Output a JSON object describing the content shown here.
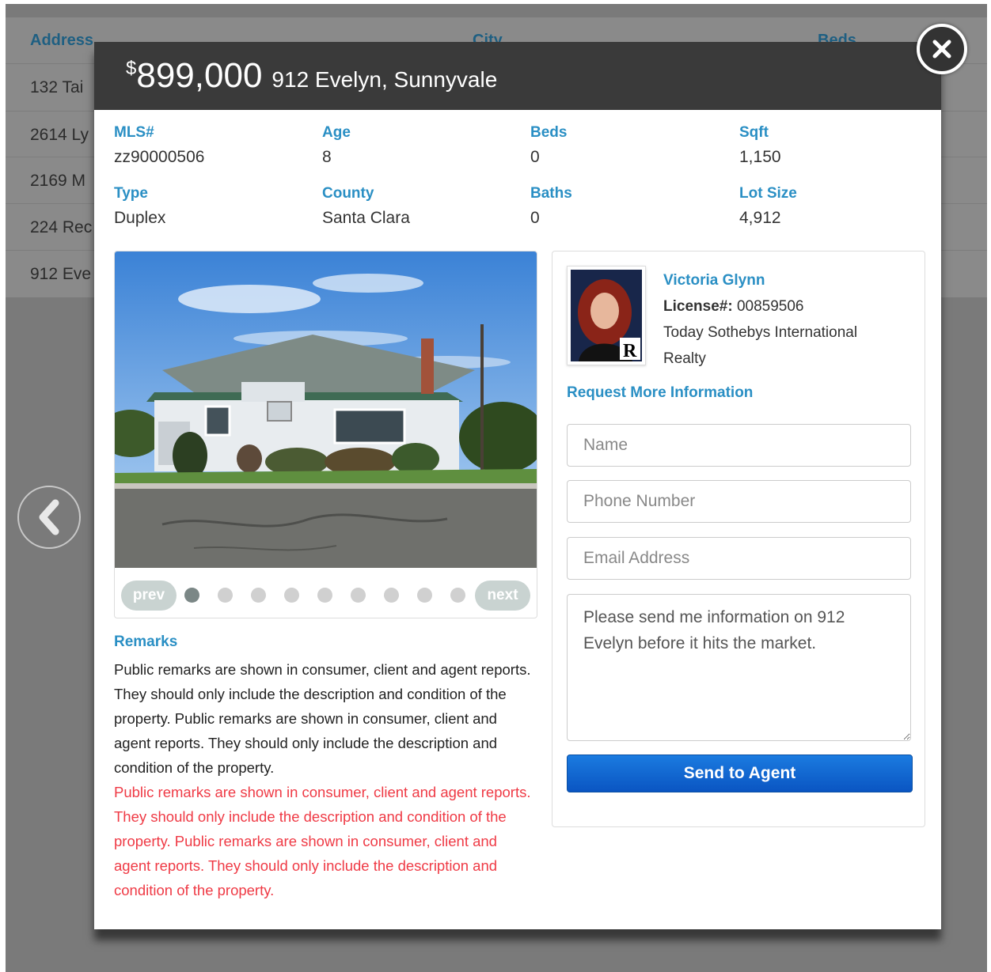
{
  "background": {
    "table_headers": [
      "Address",
      "City",
      "Beds"
    ],
    "rows": [
      "132 Tai",
      "2614 Ly",
      "2169 M",
      "224 Rec",
      "912 Eve"
    ]
  },
  "listing": {
    "price_symbol": "$",
    "price": "899,000",
    "address": "912 Evelyn, Sunnyvale"
  },
  "facts": {
    "mls_label": "MLS#",
    "mls_value": "zz90000506",
    "age_label": "Age",
    "age_value": "8",
    "beds_label": "Beds",
    "beds_value": "0",
    "sqft_label": "Sqft",
    "sqft_value": "1,150",
    "type_label": "Type",
    "type_value": "Duplex",
    "county_label": "County",
    "county_value": "Santa Clara",
    "baths_label": "Baths",
    "baths_value": "0",
    "lot_label": "Lot Size",
    "lot_value": "4,912"
  },
  "carousel": {
    "prev_label": "prev",
    "next_label": "next",
    "photo_count": 9,
    "active_index": 0
  },
  "remarks": {
    "title": "Remarks",
    "text": "Public remarks are shown in consumer, client and agent reports. They should only include the description and condition of the property.  Public remarks are shown in consumer, client and agent reports. They should only include the description and condition of the property.",
    "red_text": "Public remarks are shown in consumer, client and agent reports. They should only include the description and condition of the property.  Public remarks are shown in consumer, client and agent reports. They should only include the description and condition of the property."
  },
  "agent": {
    "name": "Victoria Glynn",
    "license_label": "License#:",
    "license_number": "00859506",
    "brokerage": "Today Sothebys International Realty"
  },
  "form": {
    "title": "Request More Information",
    "name_placeholder": "Name",
    "phone_placeholder": "Phone Number",
    "email_placeholder": "Email Address",
    "message_value": "Please send me information on 912 Evelyn before it hits the market.",
    "submit_label": "Send to Agent"
  },
  "colors": {
    "accent": "#2a8fc4",
    "header_bg": "#3a3a3a",
    "remarks_red": "#ef3a45",
    "button_blue": "#0a55c2"
  },
  "icons": {
    "close": "close-icon",
    "prev": "chevron-left-icon",
    "realtor": "realtor-r-logo"
  }
}
